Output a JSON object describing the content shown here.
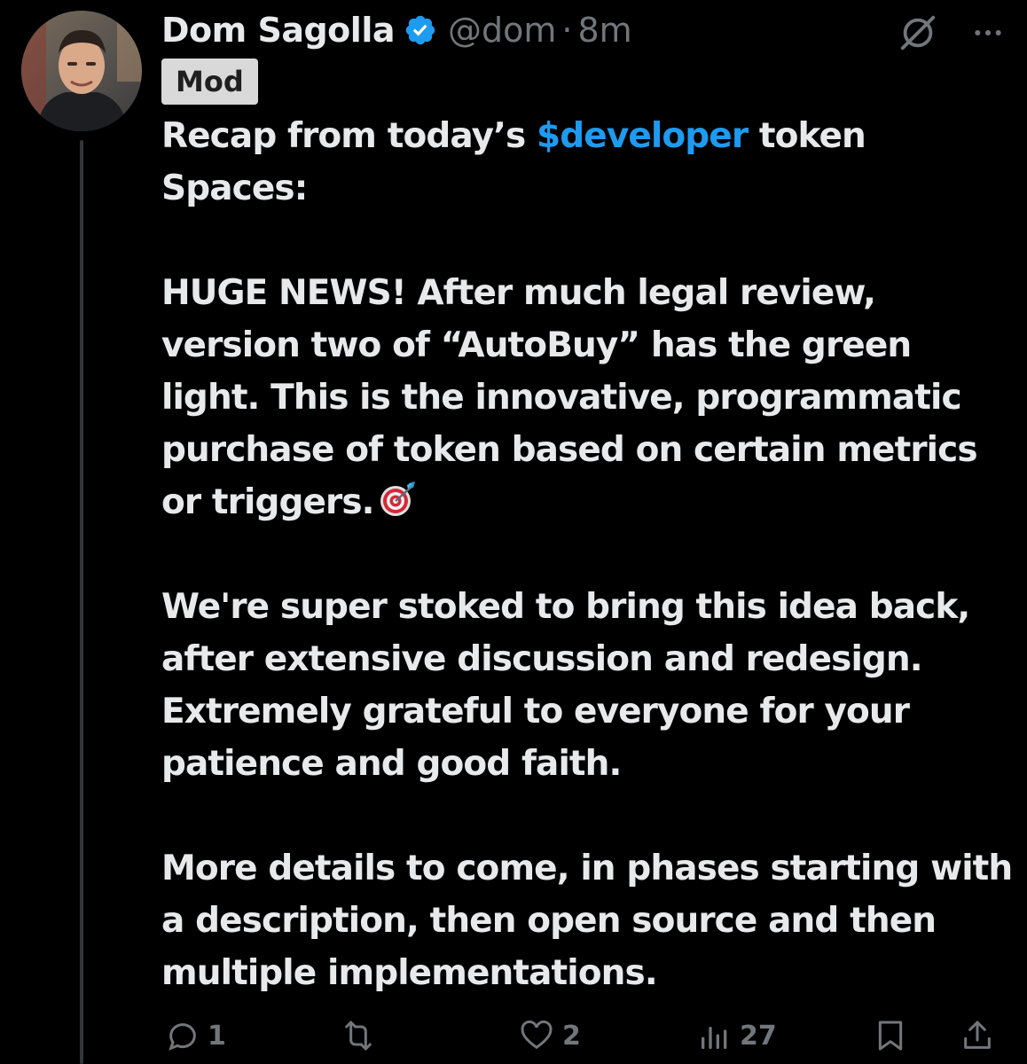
{
  "post": {
    "author": {
      "display_name": "Dom Sagolla",
      "handle": "@dom",
      "verified": true
    },
    "separator": "·",
    "time": "8m",
    "badge": "Mod",
    "text": {
      "line1_before": "Recap from today’s ",
      "cashtag": "$developer",
      "line1_after": " token Spaces:",
      "para2": "HUGE NEWS! After much legal review, version two of “AutoBuy” has the green light. This is the innovative, programmatic purchase of token based on certain metrics or triggers.",
      "para2_emoji": "direct-hit-icon",
      "para3": "We're super stoked to bring this idea back, after extensive discussion and redesign. Extremely grateful to everyone for your patience and good faith.",
      "para4": "More details to come, in phases starting with a description, then open source and then multiple implementations."
    },
    "actions": {
      "reply_count": "1",
      "repost_count": "",
      "like_count": "2",
      "views_count": "27"
    }
  },
  "colors": {
    "background": "#000000",
    "text": "#e7e9ea",
    "muted": "#71767b",
    "link": "#1d9bf0",
    "verified": "#1d9bf0",
    "badge_bg": "#d9d9d9"
  }
}
